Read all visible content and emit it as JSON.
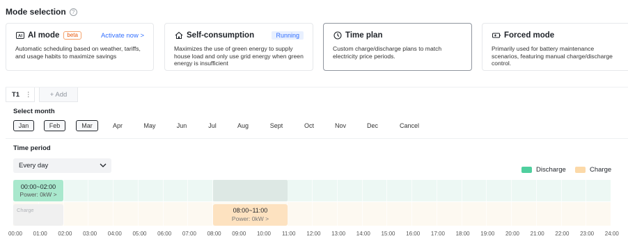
{
  "header": {
    "title": "Mode selection",
    "help_icon": "?"
  },
  "modes": [
    {
      "name": "AI mode",
      "icon": "ai-icon",
      "badge": "beta",
      "link": "Activate now >",
      "desc": "Automatic scheduling based on weather, tariffs, and usage habits to maximize savings"
    },
    {
      "name": "Self-consumption",
      "icon": "home-icon",
      "status": "Running",
      "desc": "Maximizes the use of green energy to supply house load and only use grid energy when green energy is insufficient"
    },
    {
      "name": "Time plan",
      "icon": "clock-icon",
      "selected": true,
      "desc": "Custom charge/discharge plans to match electricity price periods."
    },
    {
      "name": "Forced mode",
      "icon": "battery-icon",
      "desc": "Primarily used for battery maintenance scenarios, featuring manual charge/discharge control."
    }
  ],
  "tabs": {
    "current": "T1",
    "more": "⋮",
    "add": "+ Add"
  },
  "month_section": {
    "label": "Select month",
    "months": [
      "Jan",
      "Feb",
      "Mar",
      "Apr",
      "May",
      "Jun",
      "Jul",
      "Aug",
      "Sept",
      "Oct",
      "Nov",
      "Dec",
      "Cancel"
    ],
    "selected": [
      "Jan",
      "Feb",
      "Mar"
    ]
  },
  "period_section": {
    "label": "Time period",
    "select_value": "Every day"
  },
  "legend": {
    "discharge": "Discharge",
    "charge": "Charge",
    "discharge_color": "#4fcf9e",
    "charge_color": "#fcd9a8"
  },
  "timeline": {
    "discharge_block": {
      "time": "00:00~02:00",
      "power": "Power: 0kW >"
    },
    "charge_block": {
      "time": "08:00~11:00",
      "power": "Power: 0kW >"
    },
    "charge_placeholder": "Charge",
    "hours": [
      "00:00",
      "01:00",
      "02:00",
      "03:00",
      "04:00",
      "05:00",
      "06:00",
      "07:00",
      "08:00",
      "09:00",
      "10:00",
      "11:00",
      "12:00",
      "13:00",
      "14:00",
      "15:00",
      "16:00",
      "17:00",
      "18:00",
      "19:00",
      "20:00",
      "21:00",
      "22:00",
      "23:00",
      "24:00"
    ]
  }
}
